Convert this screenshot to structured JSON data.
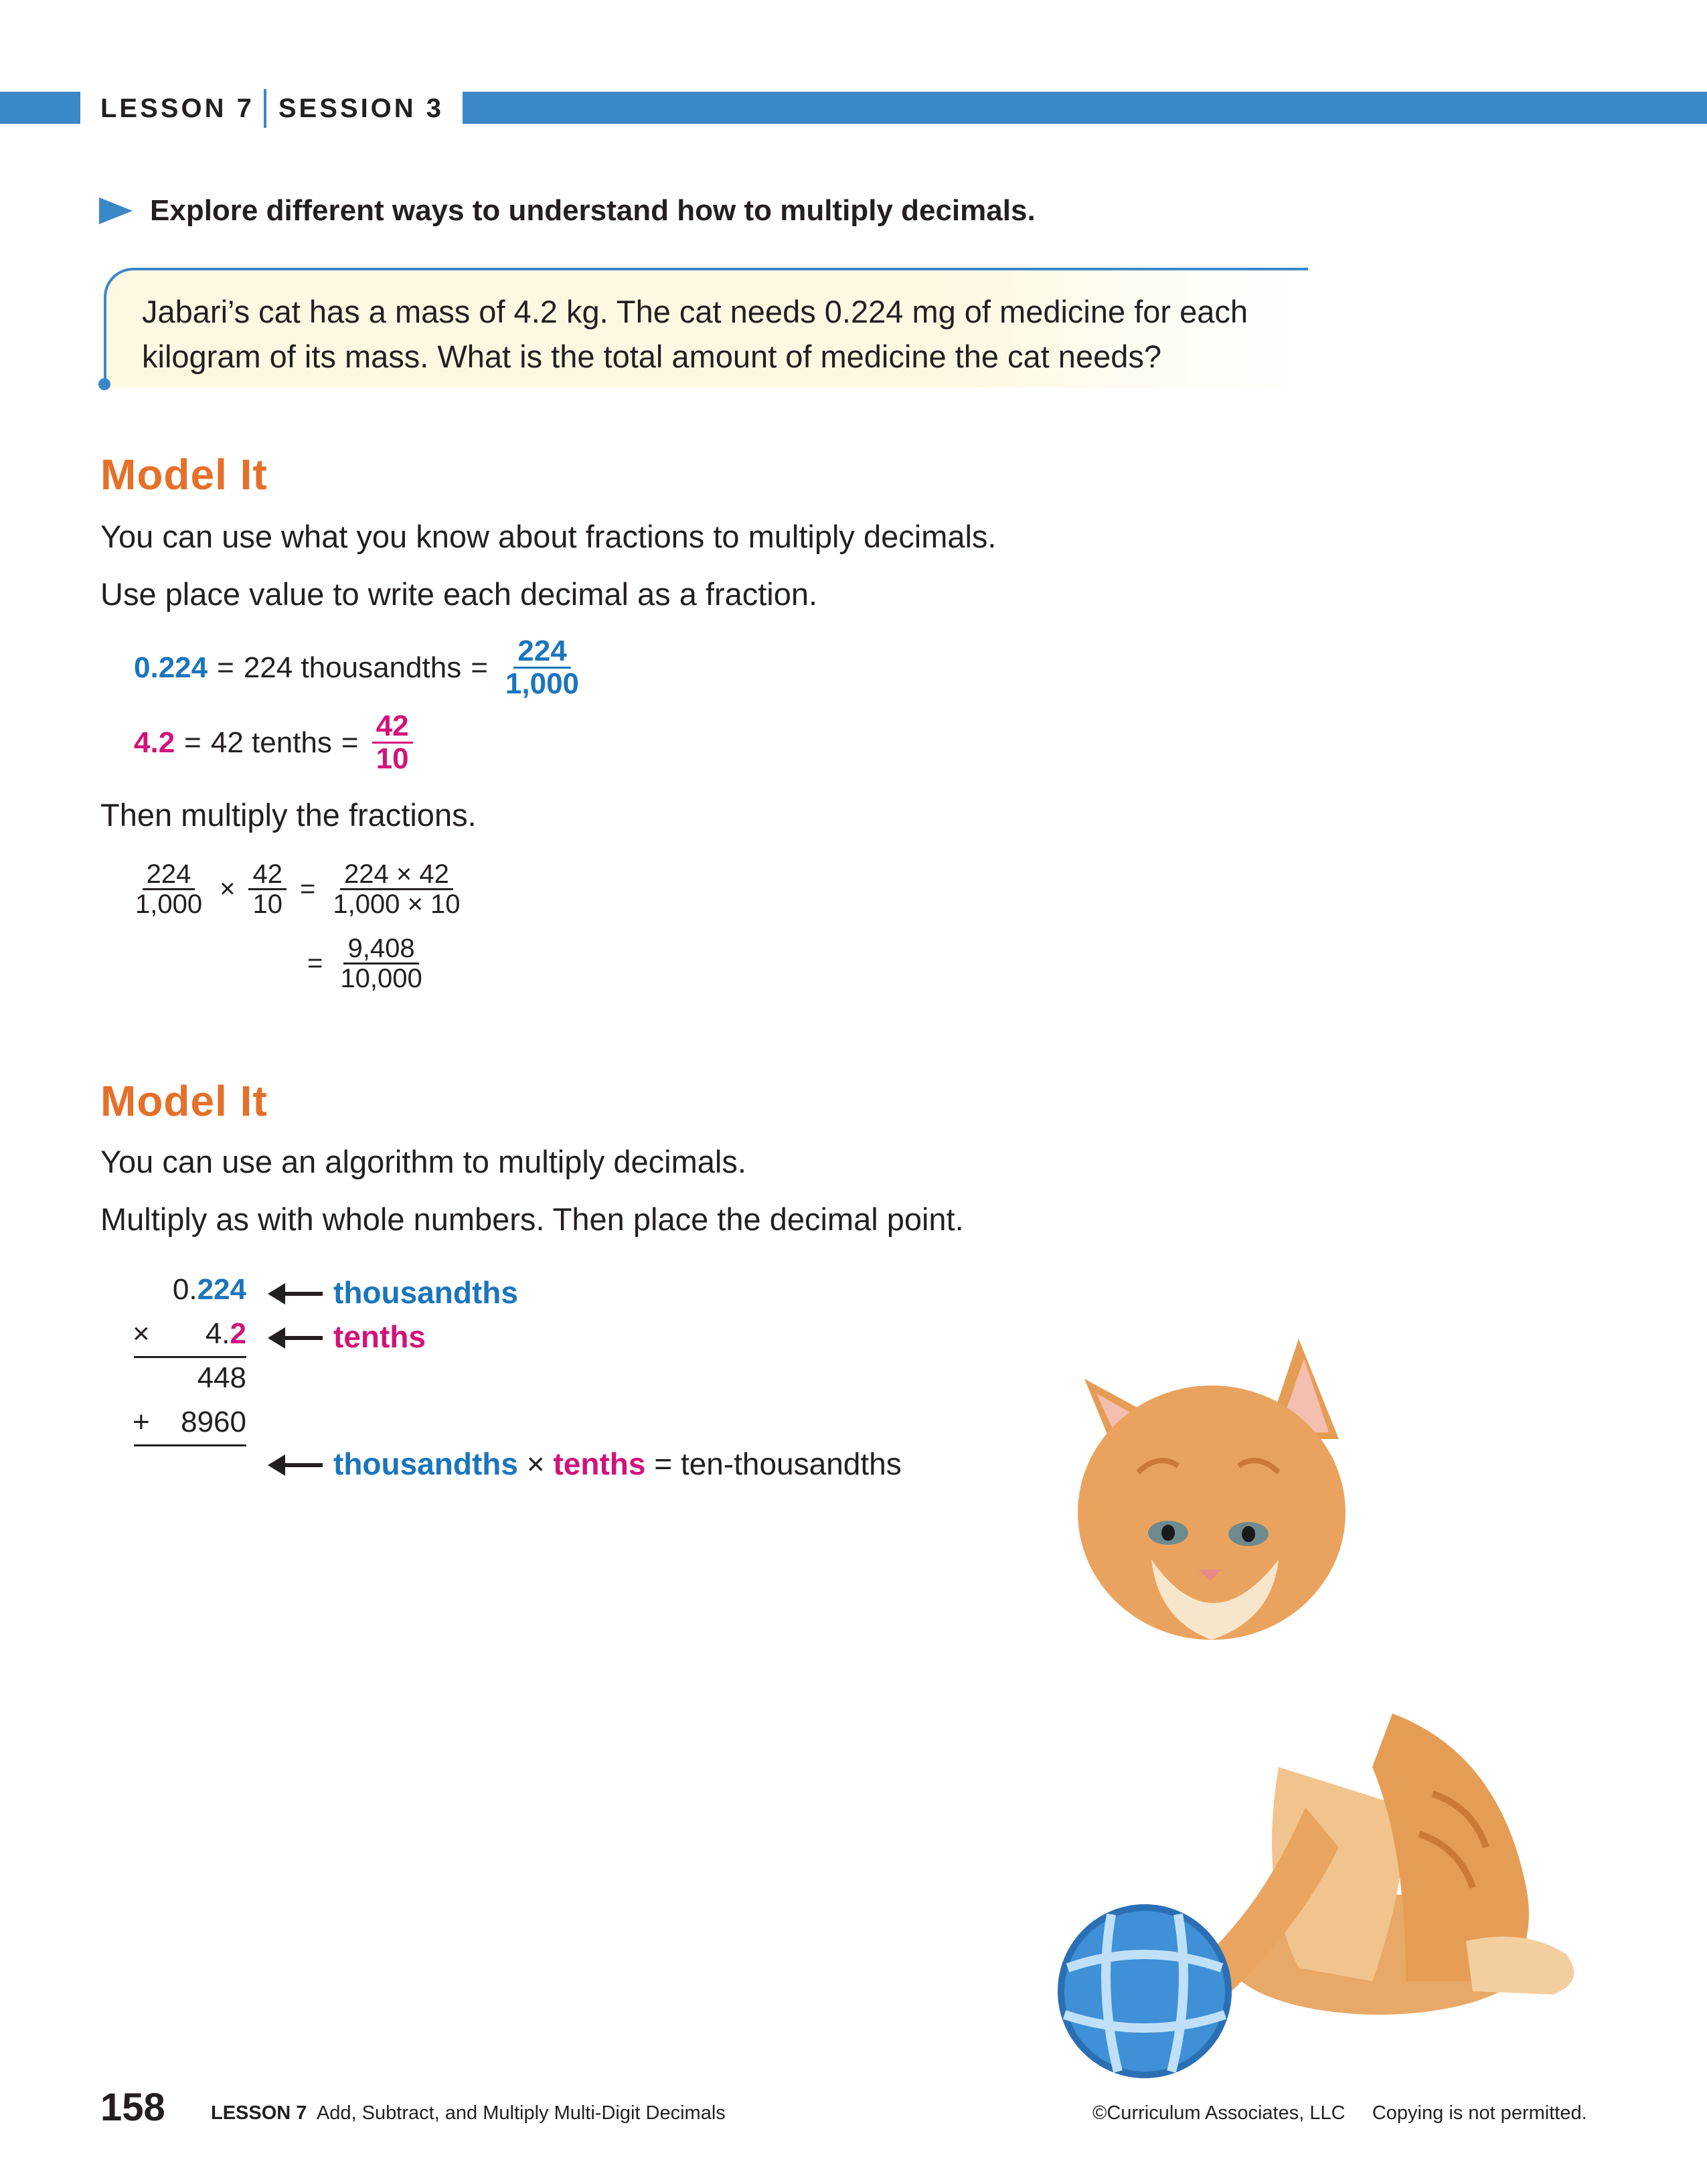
{
  "header": {
    "lesson": "LESSON 7",
    "session": "SESSION 3"
  },
  "instruction": "Explore different ways to understand how to multiply decimals.",
  "problem": "Jabari’s cat has a mass of 4.2 kg. The cat needs 0.224 mg of medicine for each kilogram of its mass. What is the total amount of medicine the cat needs?",
  "model1": {
    "heading": "Model It",
    "line1": "You can use what you know about fractions to multiply decimals.",
    "line2": "Use place value to write each decimal as a fraction.",
    "eq1": {
      "decimal": "0.224",
      "words": "224 thousandths",
      "num": "224",
      "den": "1,000"
    },
    "eq2": {
      "decimal": "4.2",
      "words": "42 tenths",
      "num": "42",
      "den": "10"
    },
    "line3": "Then multiply the fractions.",
    "mult": {
      "f1_num": "224",
      "f1_den": "1,000",
      "f2_num": "42",
      "f2_den": "10",
      "f3_num": "224 × 42",
      "f3_den": "1,000 × 10",
      "f4_num": "9,408",
      "f4_den": "10,000"
    }
  },
  "model2": {
    "heading": "Model It",
    "line1": "You can use an algorithm to multiply decimals.",
    "line2": "Multiply as with whole numbers. Then place the decimal point.",
    "algorithm": {
      "top_prefix": "0.",
      "top_digits": "224",
      "times": "×",
      "second_prefix": "4.",
      "second_digit": "2",
      "partial1": "448",
      "plus": "+",
      "partial2": "8960",
      "label_thousandths": "thousandths",
      "label_tenths": "tenths",
      "result_thousandths": "thousandths",
      "result_times": "×",
      "result_tenths": "tenths",
      "result_equals": "= ten-thousandths"
    }
  },
  "footer": {
    "page": "158",
    "lesson": "LESSON 7",
    "title": "Add, Subtract, and Multiply Multi-Digit Decimals",
    "copyright": "©Curriculum Associates, LLC",
    "notice": "Copying is not permitted."
  },
  "colors": {
    "accent_blue": "#3b88c8",
    "heading_orange": "#e5702a",
    "value_blue": "#1b75bc",
    "value_magenta": "#d1127a"
  }
}
